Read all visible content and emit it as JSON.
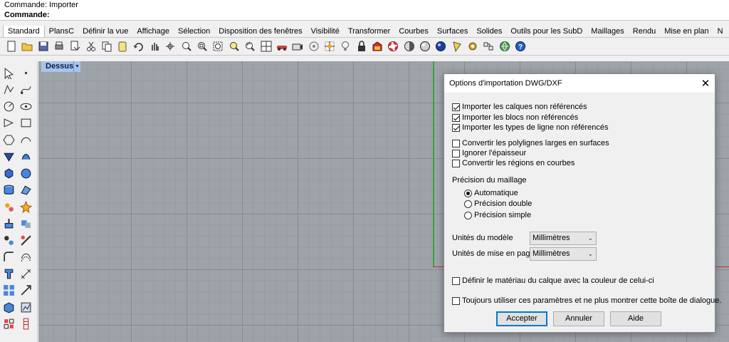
{
  "command": {
    "history": "Commande: Importer",
    "prompt": "Commande:"
  },
  "tabs": [
    "Standard",
    "PlansC",
    "Définir la vue",
    "Affichage",
    "Sélection",
    "Disposition des fenêtres",
    "Visibilité",
    "Transformer",
    "Courbes",
    "Surfaces",
    "Solides",
    "Outils pour les SubD",
    "Maillages",
    "Rendu",
    "Mise en plan",
    "N"
  ],
  "viewport": {
    "name": "Dessus"
  },
  "dialog": {
    "title": "Options d'importation DWG/DXF",
    "checkboxes": [
      {
        "label": "Importer les calques non référencés",
        "checked": true
      },
      {
        "label": "Importer les blocs non référencés",
        "checked": true
      },
      {
        "label": "Importer les types de ligne non référencés",
        "checked": true
      },
      {
        "label": "Convertir les polylignes larges en surfaces",
        "checked": false
      },
      {
        "label": "Ignorer l'épaisseur",
        "checked": false
      },
      {
        "label": "Convertir les régions en courbes",
        "checked": false
      }
    ],
    "mesh_precision": {
      "label": "Précision du maillage",
      "options": [
        "Automatique",
        "Précision double",
        "Précision simple"
      ],
      "selected": "Automatique"
    },
    "model_units": {
      "label": "Unités du modèle",
      "value": "Millimètres"
    },
    "page_units": {
      "label": "Unités de mise en page",
      "value": "Millimètres"
    },
    "layer_material": {
      "label": "Définir le matériau du calque avec la couleur de celui-ci",
      "checked": false
    },
    "always_use": {
      "label": "Toujours utiliser ces paramètres et ne plus montrer cette boîte de dialogue.",
      "checked": false
    },
    "buttons": {
      "accept": "Accepter",
      "cancel": "Annuler",
      "help": "Aide"
    }
  },
  "toolbar_icons": [
    "new-file-icon",
    "open-file-icon",
    "save-icon",
    "print-icon",
    "import-icon",
    "cut-icon",
    "copy-icon",
    "paste-icon",
    "undo-icon",
    "pan-hand-icon",
    "rotate-view-icon",
    "zoom-dynamic-icon",
    "zoom-window-icon",
    "zoom-extents-icon",
    "zoom-selected-icon",
    "undo-view-icon",
    "four-viewports-icon",
    "named-view-car-icon",
    "camera-icon",
    "object-properties-icon",
    "grid-snap-icon",
    "light-bulb-icon",
    "lock-icon",
    "material-icon",
    "color-wheel-icon",
    "shaded-sphere-icon",
    "rendered-sphere-icon",
    "environment-sphere-icon",
    "spotlight-icon",
    "gear-options-icon",
    "check-objects-icon",
    "globe-icon",
    "help-icon"
  ],
  "left_tool_icons": [
    "select-arrow-icon",
    "point-icon",
    "polyline-icon",
    "curve-icon",
    "circle-icon",
    "ellipse-icon",
    "polygon-icon",
    "rectangle-icon",
    "hexagon-icon",
    "arc-icon",
    "surface-from-curves-icon",
    "sweep-icon",
    "box-solid-icon",
    "sphere-solid-icon",
    "cylinder-solid-icon",
    "mesh-icon",
    "explode-icon",
    "burst-icon",
    "extrude-icon",
    "boolean-icon",
    "group-icon",
    "trim-icon",
    "fillet-icon",
    "offset-icon",
    "text-icon",
    "dimension-icon",
    "array-icon",
    "transform-icon",
    "block-icon",
    "analysis-icon",
    "layout-icon",
    "annotation-icon"
  ]
}
